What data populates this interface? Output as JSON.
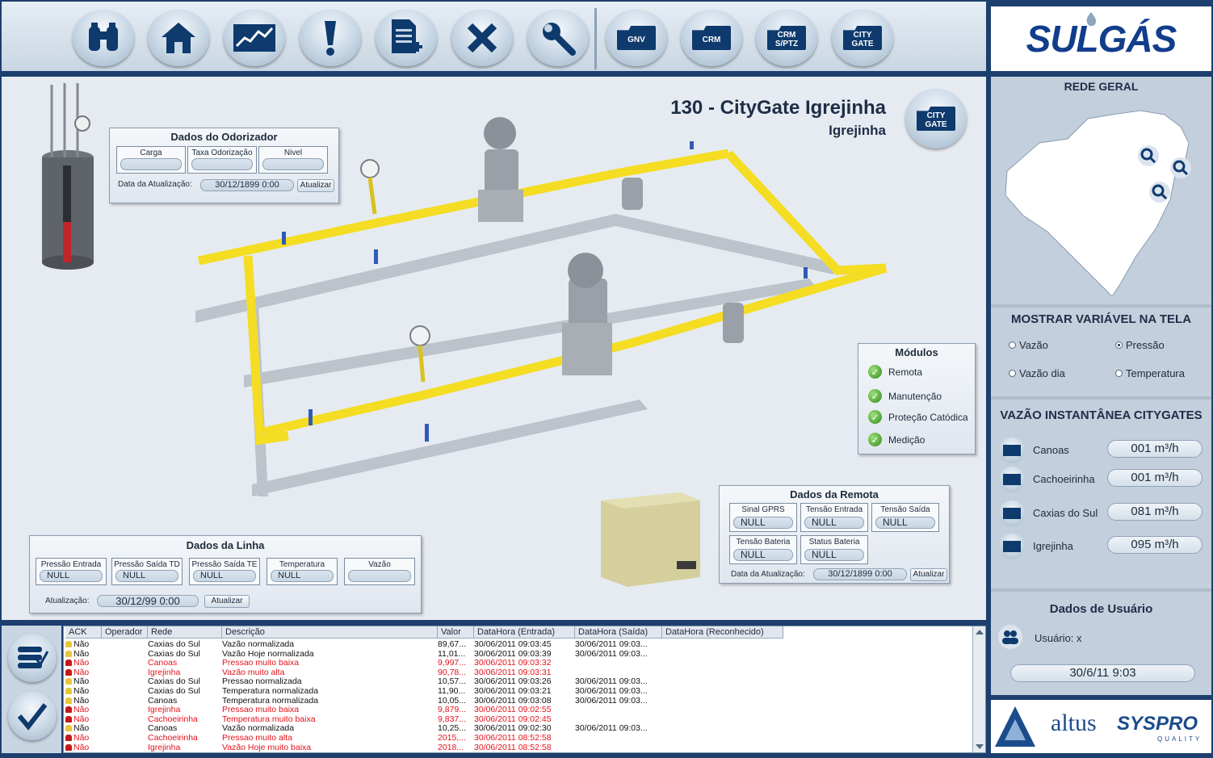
{
  "toolbar": {
    "buttons": [
      {
        "name": "binoculars-button",
        "icon": "binoculars-icon"
      },
      {
        "name": "home-button",
        "icon": "home-icon"
      },
      {
        "name": "trend-button",
        "icon": "chart-line-icon"
      },
      {
        "name": "alarm-button",
        "icon": "exclamation-icon"
      },
      {
        "name": "report-button",
        "icon": "document-add-icon"
      },
      {
        "name": "close-button",
        "icon": "close-icon"
      },
      {
        "name": "tools-button",
        "icon": "wrench-icon"
      }
    ],
    "folders": [
      {
        "line1": "GNV",
        "line2": ""
      },
      {
        "line1": "CRM",
        "line2": ""
      },
      {
        "line1": "CRM",
        "line2": "S/PTZ"
      },
      {
        "line1": "CITY",
        "line2": "GATE"
      }
    ]
  },
  "logo": {
    "text": "SULGÁS"
  },
  "station": {
    "title": "130 - CityGate Igrejinha",
    "subtitle": "Igrejinha",
    "city_button": {
      "line1": "CITY",
      "line2": "GATE"
    }
  },
  "odorizador": {
    "title": "Dados do Odorizador",
    "fields": [
      {
        "label": "Carga",
        "value": ""
      },
      {
        "label": "Taxa Odorização",
        "value": ""
      },
      {
        "label": "Nivel",
        "value": ""
      }
    ],
    "update_label": "Data da Atualização:",
    "update_value": "30/12/1899 0:00",
    "update_button": "Atualizar"
  },
  "linha": {
    "title": "Dados da Linha",
    "fields": [
      {
        "label": "Pressão Entrada",
        "value": "NULL"
      },
      {
        "label": "Pressão Saída TD",
        "value": "NULL"
      },
      {
        "label": "Pressão Saída TE",
        "value": "NULL"
      },
      {
        "label": "Temperatura",
        "value": "NULL"
      },
      {
        "label": "Vazão",
        "value": ""
      }
    ],
    "update_label": "Atualização:",
    "update_value": "30/12/99 0:00",
    "update_button": "Atualizar"
  },
  "modulos": {
    "title": "Módulos",
    "items": [
      "Remota",
      "Manutenção",
      "Proteção Catódica",
      "Medição"
    ]
  },
  "remota": {
    "title": "Dados da Remota",
    "fields": [
      {
        "label": "Sinal GPRS",
        "value": "NULL"
      },
      {
        "label": "Tensão Entrada",
        "value": "NULL"
      },
      {
        "label": "Tensão Saída",
        "value": "NULL"
      },
      {
        "label": "Tensão Bateria",
        "value": "NULL"
      },
      {
        "label": "Status Bateria",
        "value": "NULL"
      }
    ],
    "update_label": "Data da Atualização:",
    "update_value": "30/12/1899 0:00",
    "update_button": "Atualizar"
  },
  "sidebar": {
    "rede_title": "REDE GERAL",
    "mostrar_title": "MOSTRAR VARIÁVEL NA TELA",
    "options": [
      {
        "label": "Vazão",
        "selected": false
      },
      {
        "label": "Pressão",
        "selected": true
      },
      {
        "label": "Vazão dia",
        "selected": false
      },
      {
        "label": "Temperatura",
        "selected": false
      }
    ],
    "vazao_title": "VAZÃO INSTANTÂNEA CITYGATES",
    "flows": [
      {
        "name": "Canoas",
        "value": "001 m³/h"
      },
      {
        "name": "Cachoeirinha",
        "value": "001 m³/h"
      },
      {
        "name": "Caxias do Sul",
        "value": "081 m³/h"
      },
      {
        "name": "Igrejinha",
        "value": "095 m³/h"
      }
    ],
    "user_title": "Dados de Usuário",
    "user_label": "Usuário:",
    "user_value": "x",
    "datetime": "30/6/11 9:03"
  },
  "footer_logos": {
    "altus": "altus",
    "syspro": "SYSPRO",
    "syspro_sub": "QUALITY"
  },
  "alarms": {
    "columns": [
      "ACK",
      "Operador",
      "Rede",
      "Descrição",
      "Valor",
      "DataHora (Entrada)",
      "DataHora (Saída)",
      "DataHora (Reconhecido)"
    ],
    "rows": [
      {
        "ack": "Não",
        "op": "",
        "rede": "Caxias do Sul",
        "desc": "Vazão normalizada",
        "valor": "89,67...",
        "in": "30/06/2011 09:03:45",
        "out": "30/06/2011 09:03...",
        "rec": "",
        "alarm": false
      },
      {
        "ack": "Não",
        "op": "",
        "rede": "Caxias do Sul",
        "desc": "Vazão Hoje normalizada",
        "valor": "11,01...",
        "in": "30/06/2011 09:03:39",
        "out": "30/06/2011 09:03...",
        "rec": "",
        "alarm": false
      },
      {
        "ack": "Não",
        "op": "",
        "rede": "Canoas",
        "desc": "Pressao muito baixa",
        "valor": "9,997...",
        "in": "30/06/2011 09:03:32",
        "out": "",
        "rec": "",
        "alarm": true
      },
      {
        "ack": "Não",
        "op": "",
        "rede": "Igrejinha",
        "desc": "Vazão muito alta",
        "valor": "90,78...",
        "in": "30/06/2011 09:03:31",
        "out": "",
        "rec": "",
        "alarm": true
      },
      {
        "ack": "Não",
        "op": "",
        "rede": "Caxias do Sul",
        "desc": "Pressao normalizada",
        "valor": "10,57...",
        "in": "30/06/2011 09:03:26",
        "out": "30/06/2011 09:03...",
        "rec": "",
        "alarm": false
      },
      {
        "ack": "Não",
        "op": "",
        "rede": "Caxias do Sul",
        "desc": "Temperatura normalizada",
        "valor": "11,90...",
        "in": "30/06/2011 09:03:21",
        "out": "30/06/2011 09:03...",
        "rec": "",
        "alarm": false
      },
      {
        "ack": "Não",
        "op": "",
        "rede": "Canoas",
        "desc": "Temperatura normalizada",
        "valor": "10,05...",
        "in": "30/06/2011 09:03:08",
        "out": "30/06/2011 09:03...",
        "rec": "",
        "alarm": false
      },
      {
        "ack": "Não",
        "op": "",
        "rede": "Igrejinha",
        "desc": "Pressao muito baixa",
        "valor": "9,879...",
        "in": "30/06/2011 09:02:55",
        "out": "",
        "rec": "",
        "alarm": true
      },
      {
        "ack": "Não",
        "op": "",
        "rede": "Cachoeirinha",
        "desc": "Temperatura muito baixa",
        "valor": "9,837...",
        "in": "30/06/2011 09:02:45",
        "out": "",
        "rec": "",
        "alarm": true
      },
      {
        "ack": "Não",
        "op": "",
        "rede": "Canoas",
        "desc": "Vazão normalizada",
        "valor": "10,25...",
        "in": "30/06/2011 09:02:30",
        "out": "30/06/2011 09:03...",
        "rec": "",
        "alarm": false
      },
      {
        "ack": "Não",
        "op": "",
        "rede": "Cachoeirinha",
        "desc": "Pressao muito alta",
        "valor": "2015,...",
        "in": "30/06/2011 08:52:58",
        "out": "",
        "rec": "",
        "alarm": true
      },
      {
        "ack": "Não",
        "op": "",
        "rede": "Igrejinha",
        "desc": "Vazão Hoje muito baixa",
        "valor": "2018...",
        "in": "30/06/2011 08:52:58",
        "out": "",
        "rec": "",
        "alarm": true
      }
    ]
  },
  "colors": {
    "alarm_red": "#e4121b",
    "normal": "#111111",
    "pipe": "#f2d81a",
    "frame": "#1d3f6e"
  }
}
